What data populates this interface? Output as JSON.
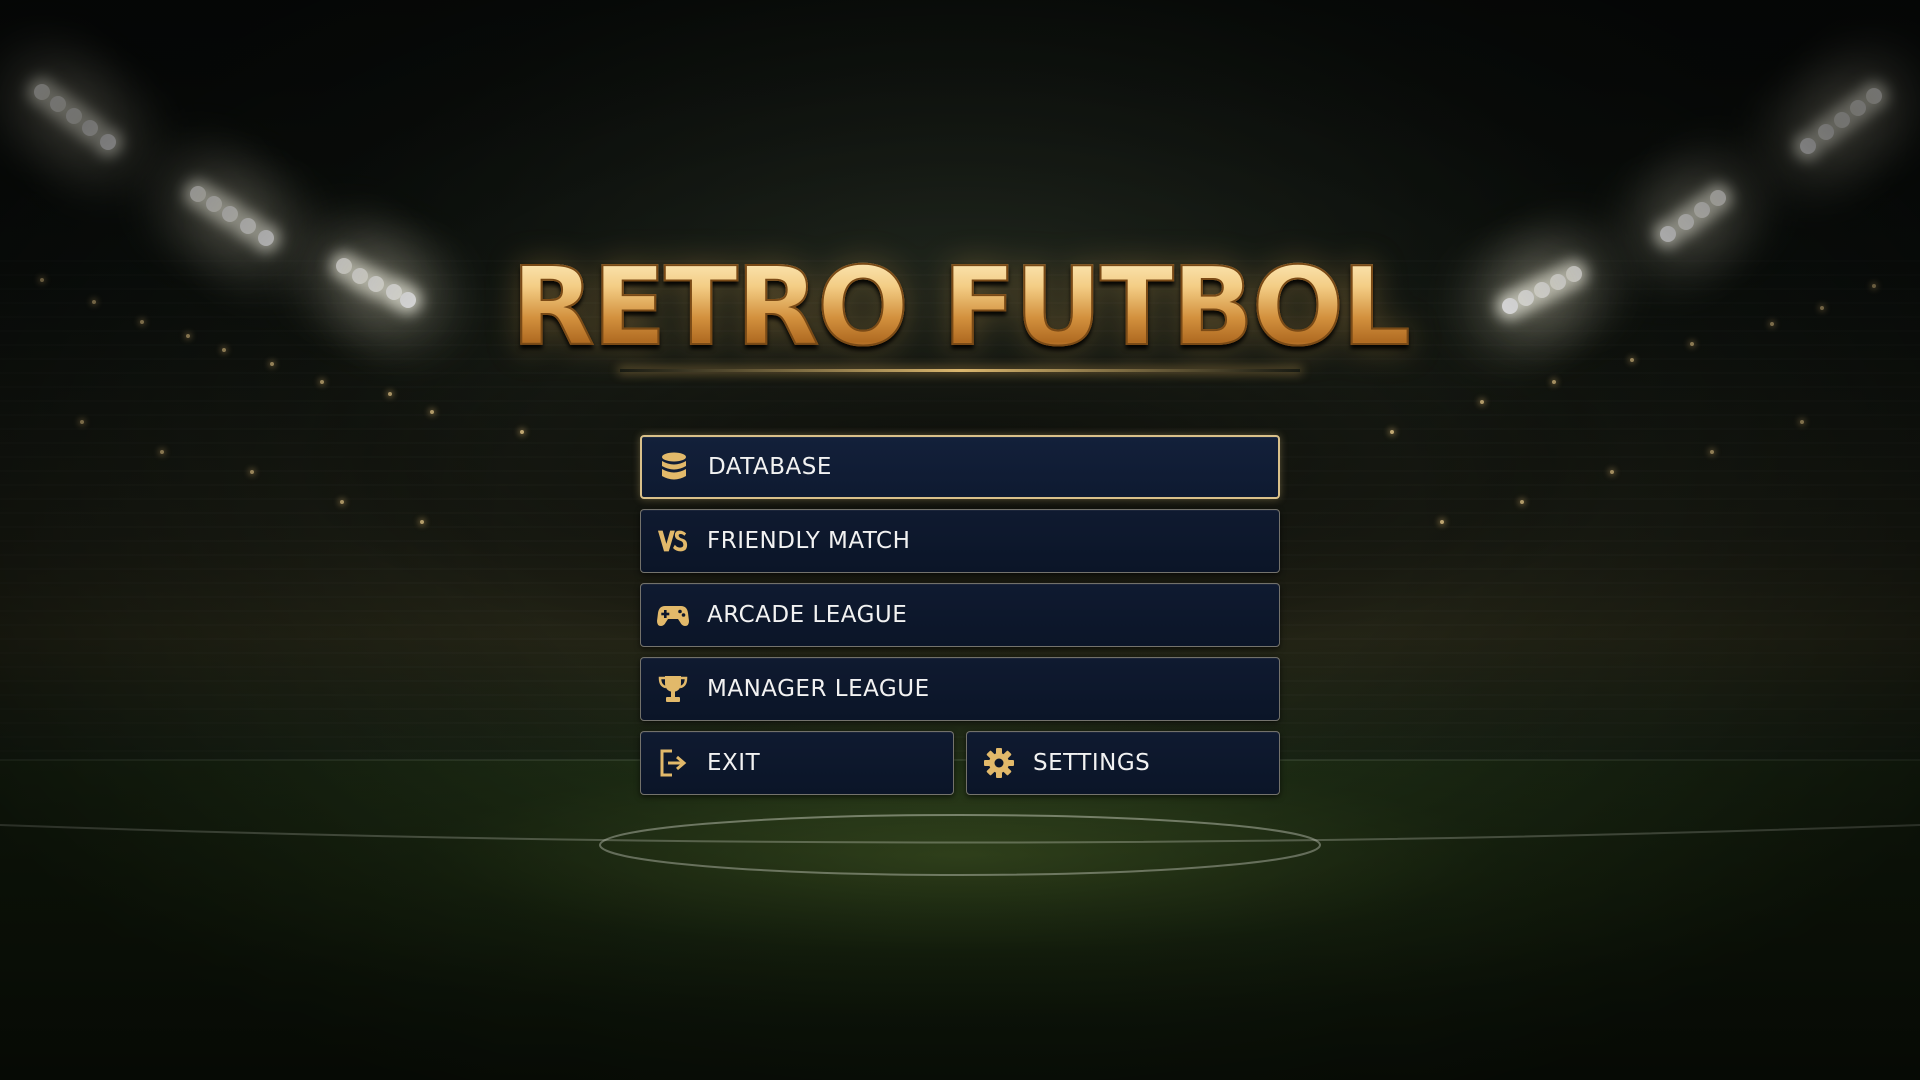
{
  "game": {
    "title": "RETRO FUTBOL"
  },
  "menu": {
    "selected_index": 0,
    "items": [
      {
        "id": "database",
        "label": "DATABASE",
        "icon": "database-icon"
      },
      {
        "id": "friendly-match",
        "label": "FRIENDLY MATCH",
        "icon": "vs-icon"
      },
      {
        "id": "arcade-league",
        "label": "ARCADE LEAGUE",
        "icon": "gamepad-icon"
      },
      {
        "id": "manager-league",
        "label": "MANAGER LEAGUE",
        "icon": "trophy-icon"
      },
      {
        "id": "exit",
        "label": "EXIT",
        "icon": "exit-icon"
      },
      {
        "id": "settings",
        "label": "SETTINGS",
        "icon": "gear-icon"
      }
    ]
  },
  "colors": {
    "accent_gold": "#e2b96a",
    "button_bg": "#0d172c",
    "button_border": "#c8be9f",
    "label_text": "#f2f2f2"
  }
}
